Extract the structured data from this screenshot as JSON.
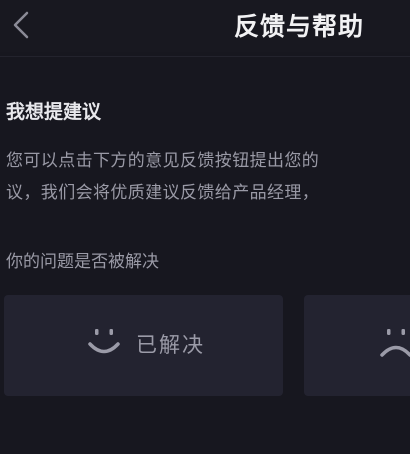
{
  "header": {
    "back_icon": "chevron-left-icon",
    "title": "反馈与帮助"
  },
  "suggestion": {
    "title": "我想提建议",
    "line1": "您可以点击下方的意见反馈按钮提出您的",
    "line2": "议，我们会将优质建议反馈给产品经理，"
  },
  "resolution": {
    "question": "你的问题是否被解决",
    "resolved": {
      "label": "已解决",
      "icon": "smile-face-icon"
    },
    "unresolved": {
      "label": "",
      "icon": "sad-face-icon"
    }
  },
  "colors": {
    "background": "#17171f",
    "card": "#232330",
    "title_text": "#f2f2f4",
    "secondary_text": "#9a9aa6"
  }
}
